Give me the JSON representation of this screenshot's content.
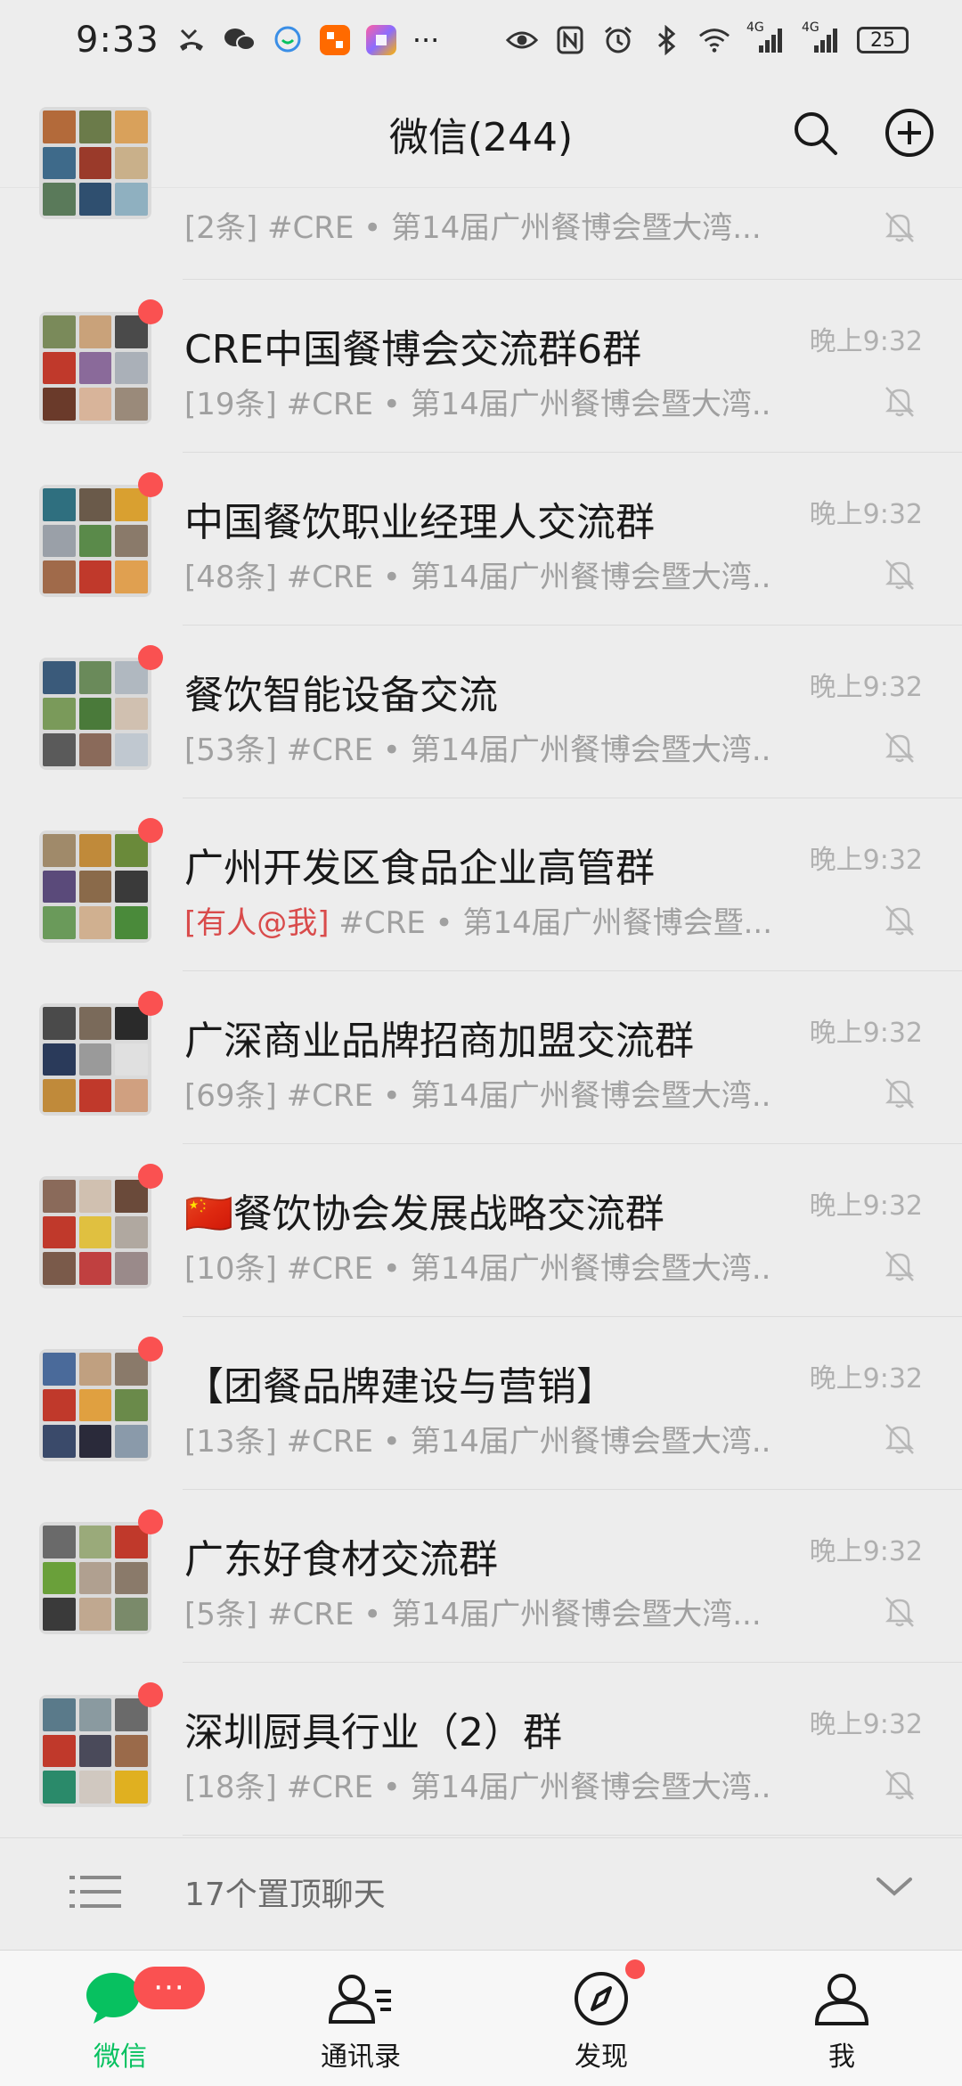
{
  "status_bar": {
    "time": "9:33",
    "more": "···",
    "battery": "25",
    "signal_label": "4G"
  },
  "header": {
    "title": "微信(244)"
  },
  "chats": [
    {
      "name": "",
      "preview_tag": "",
      "preview": "[2条] #CRE • 第14届广州餐博会暨大湾...",
      "time": "",
      "unread_dot": false,
      "tiles": [
        "#b36a3a",
        "#6b7b4a",
        "#d9a15b",
        "#3e6a8a",
        "#9a3a2a",
        "#c9b08a",
        "#5a7a5a",
        "#2f4f6f",
        "#8fb0c0"
      ]
    },
    {
      "name": "CRE中国餐博会交流群6群",
      "preview_tag": "",
      "preview": "[19条] #CRE • 第14届广州餐博会暨大湾...",
      "time": "晚上9:32",
      "unread_dot": true,
      "tiles": [
        "#7a8a5a",
        "#c9a27a",
        "#4a4a4a",
        "#c0392b",
        "#8a6a9a",
        "#aab0b8",
        "#6a3a2a",
        "#d8b49a",
        "#9a8a7a"
      ]
    },
    {
      "name": "中国餐饮职业经理人交流群",
      "preview_tag": "",
      "preview": "[48条] #CRE • 第14届广州餐博会暨大湾...",
      "time": "晚上9:32",
      "unread_dot": true,
      "tiles": [
        "#2f6f7f",
        "#6a5a4a",
        "#d9a030",
        "#9aa0a8",
        "#5a8a4a",
        "#8a7a6a",
        "#a06a4a",
        "#c0392b",
        "#e0a050"
      ]
    },
    {
      "name": "餐饮智能设备交流",
      "preview_tag": "",
      "preview": "[53条] #CRE • 第14届广州餐博会暨大湾...",
      "time": "晚上9:32",
      "unread_dot": true,
      "tiles": [
        "#3a5a7a",
        "#6a8a5a",
        "#b0b8c0",
        "#7a9a5a",
        "#4a7a3a",
        "#d0c0b0",
        "#5a5a5a",
        "#8a6a5a",
        "#c0c8d0"
      ]
    },
    {
      "name": "广州开发区食品企业高管群",
      "preview_tag": "[有人@我]",
      "preview": " #CRE • 第14届广州餐博会暨...",
      "time": "晚上9:32",
      "unread_dot": true,
      "tiles": [
        "#a08a6a",
        "#c08a3a",
        "#6a8a3a",
        "#5a4a7a",
        "#8a6a4a",
        "#3a3a3a",
        "#6a9a5a",
        "#d0b090",
        "#4a8a3a"
      ]
    },
    {
      "name": "广深商业品牌招商加盟交流群",
      "preview_tag": "",
      "preview": "[69条] #CRE • 第14届广州餐博会暨大湾...",
      "time": "晚上9:32",
      "unread_dot": true,
      "tiles": [
        "#4a4a4a",
        "#7a6a5a",
        "#2a2a2a",
        "#2a3a5a",
        "#9a9a9a",
        "#e0e0e0",
        "#c08a3a",
        "#c0392b",
        "#d0a080"
      ]
    },
    {
      "name": "🇨🇳餐饮协会发展战略交流群",
      "preview_tag": "",
      "preview": "[10条] #CRE • 第14届广州餐博会暨大湾...",
      "time": "晚上9:32",
      "unread_dot": true,
      "tiles": [
        "#8a6a5a",
        "#d0c0b0",
        "#6a4a3a",
        "#c0392b",
        "#e0c040",
        "#b0a8a0",
        "#7a5a4a",
        "#c04040",
        "#9a8a8a"
      ]
    },
    {
      "name": "【团餐品牌建设与营销】",
      "preview_tag": "",
      "preview": "[13条] #CRE • 第14届广州餐博会暨大湾...",
      "time": "晚上9:32",
      "unread_dot": true,
      "tiles": [
        "#4a6a9a",
        "#c0a080",
        "#8a7a6a",
        "#c0392b",
        "#e0a040",
        "#6a8a4a",
        "#3a4a6a",
        "#2a2a3a",
        "#8a9aaa"
      ]
    },
    {
      "name": "广东好食材交流群",
      "preview_tag": "",
      "preview": "[5条] #CRE • 第14届广州餐博会暨大湾...",
      "time": "晚上9:32",
      "unread_dot": true,
      "tiles": [
        "#6a6a6a",
        "#9aaa7a",
        "#c0392b",
        "#6aa03a",
        "#b0a090",
        "#8a7a6a",
        "#3a3a3a",
        "#c0a890",
        "#7a8a6a"
      ]
    },
    {
      "name": "深圳厨具行业（2）群",
      "preview_tag": "",
      "preview": "[18条] #CRE • 第14届广州餐博会暨大湾...",
      "time": "晚上9:32",
      "unread_dot": true,
      "tiles": [
        "#5a7a8a",
        "#8a9aa0",
        "#6a6a6a",
        "#c0392b",
        "#4a4a5a",
        "#9a6a4a",
        "#2a8a6a",
        "#d0c8c0",
        "#e0b020"
      ]
    }
  ],
  "pinned": {
    "label": "17个置顶聊天"
  },
  "tabs": [
    {
      "label": "微信",
      "badge": "···",
      "active": true
    },
    {
      "label": "通讯录",
      "active": false
    },
    {
      "label": "发现",
      "dot": true,
      "active": false
    },
    {
      "label": "我",
      "active": false
    }
  ],
  "colors": {
    "accent_green": "#07c160",
    "badge_red": "#fa5151",
    "background": "#ededed"
  }
}
